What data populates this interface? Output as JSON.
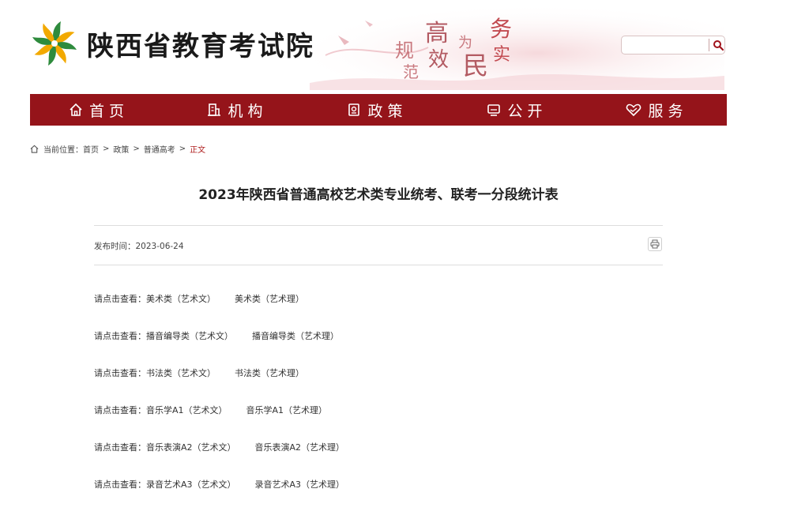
{
  "site": {
    "name": "陕西省教育考试院"
  },
  "banner": {
    "slogan_chars": [
      "规",
      "范",
      "高",
      "效",
      "为",
      "民",
      "务",
      "实"
    ]
  },
  "search": {
    "placeholder": "",
    "value": ""
  },
  "nav": [
    {
      "label": "首页",
      "icon": "home-icon"
    },
    {
      "label": "机构",
      "icon": "building-icon"
    },
    {
      "label": "政策",
      "icon": "document-icon"
    },
    {
      "label": "公开",
      "icon": "monitor-icon"
    },
    {
      "label": "服务",
      "icon": "heart-hand-icon"
    }
  ],
  "breadcrumb": {
    "prefix": "当前位置：",
    "items": [
      "首页",
      "政策",
      "普通高考"
    ],
    "current": "正文",
    "separator": ">"
  },
  "article": {
    "title": "2023年陕西省普通高校艺术类专业统考、联考一分段统计表",
    "publish_label": "发布时间：",
    "publish_date": "2023-06-24"
  },
  "links": {
    "prompt": "请点击查看：",
    "rows": [
      {
        "wen": "美术类（艺术文）",
        "li": "美术类（艺术理）"
      },
      {
        "wen": "播音编导类（艺术文）",
        "li": "播音编导类（艺术理）"
      },
      {
        "wen": "书法类（艺术文）",
        "li": "书法类（艺术理）"
      },
      {
        "wen": "音乐学A1（艺术文）",
        "li": "音乐学A1（艺术理）"
      },
      {
        "wen": "音乐表演A2（艺术文）",
        "li": "音乐表演A2（艺术理）"
      },
      {
        "wen": "录音艺术A3（艺术文）",
        "li": "录音艺术A3（艺术理）"
      }
    ]
  },
  "colors": {
    "brand_red": "#95141a",
    "breadcrumb_current": "#b02020"
  }
}
